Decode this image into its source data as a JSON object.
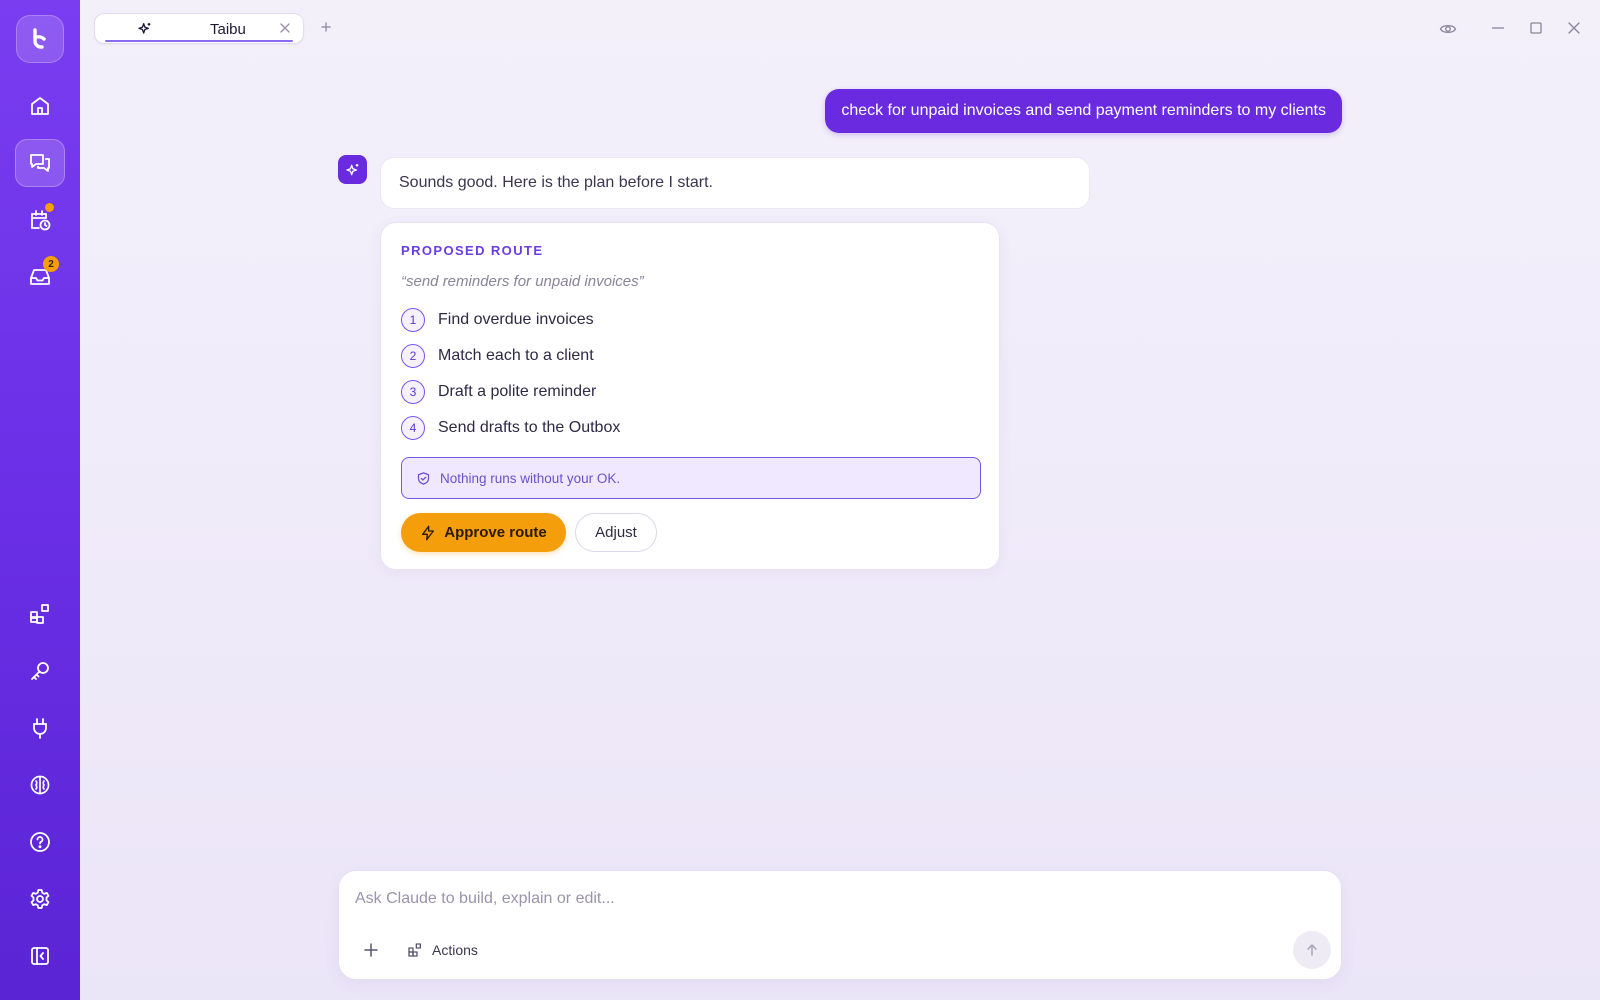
{
  "window": {
    "tab_title": "Taibu",
    "controls": [
      "eye-icon",
      "minimize-icon",
      "maximize-icon",
      "close-icon"
    ]
  },
  "sidebar": {
    "top_items": [
      {
        "name": "home",
        "icon": "home-icon"
      },
      {
        "name": "chat",
        "icon": "chat-icon",
        "active": true
      },
      {
        "name": "schedule",
        "icon": "calendar-clock-icon",
        "indicator": "dot"
      },
      {
        "name": "inbox",
        "icon": "inbox-icon",
        "badge": "2"
      }
    ],
    "bottom_items": [
      {
        "name": "apps",
        "icon": "apps-icon"
      },
      {
        "name": "keys",
        "icon": "key-icon"
      },
      {
        "name": "integrations",
        "icon": "plug-icon"
      },
      {
        "name": "brain",
        "icon": "brain-icon"
      },
      {
        "name": "help",
        "icon": "help-icon"
      },
      {
        "name": "settings",
        "icon": "gear-icon"
      },
      {
        "name": "collapse",
        "icon": "sidebar-collapse-icon"
      }
    ]
  },
  "chat": {
    "user_message": "check for unpaid invoices and send payment reminders to my clients",
    "assistant_message": "Sounds good. Here is the plan before I start.",
    "route": {
      "label": "PROPOSED ROUTE",
      "quote": "“send reminders for unpaid invoices”",
      "steps": [
        {
          "num": "1",
          "text": "Find overdue invoices"
        },
        {
          "num": "2",
          "text": "Match each to a client"
        },
        {
          "num": "3",
          "text": "Draft a polite reminder"
        },
        {
          "num": "4",
          "text": "Send drafts to the Outbox"
        }
      ],
      "notice": "Nothing runs without your OK.",
      "approve_label": "Approve route",
      "adjust_label": "Adjust"
    }
  },
  "composer": {
    "placeholder": "Ask Claude to build, explain or edit...",
    "value": "",
    "actions_label": "Actions"
  },
  "colors": {
    "brand": "#6a2be0",
    "accent": "#f59e0b",
    "background": "#f3f0fa"
  }
}
